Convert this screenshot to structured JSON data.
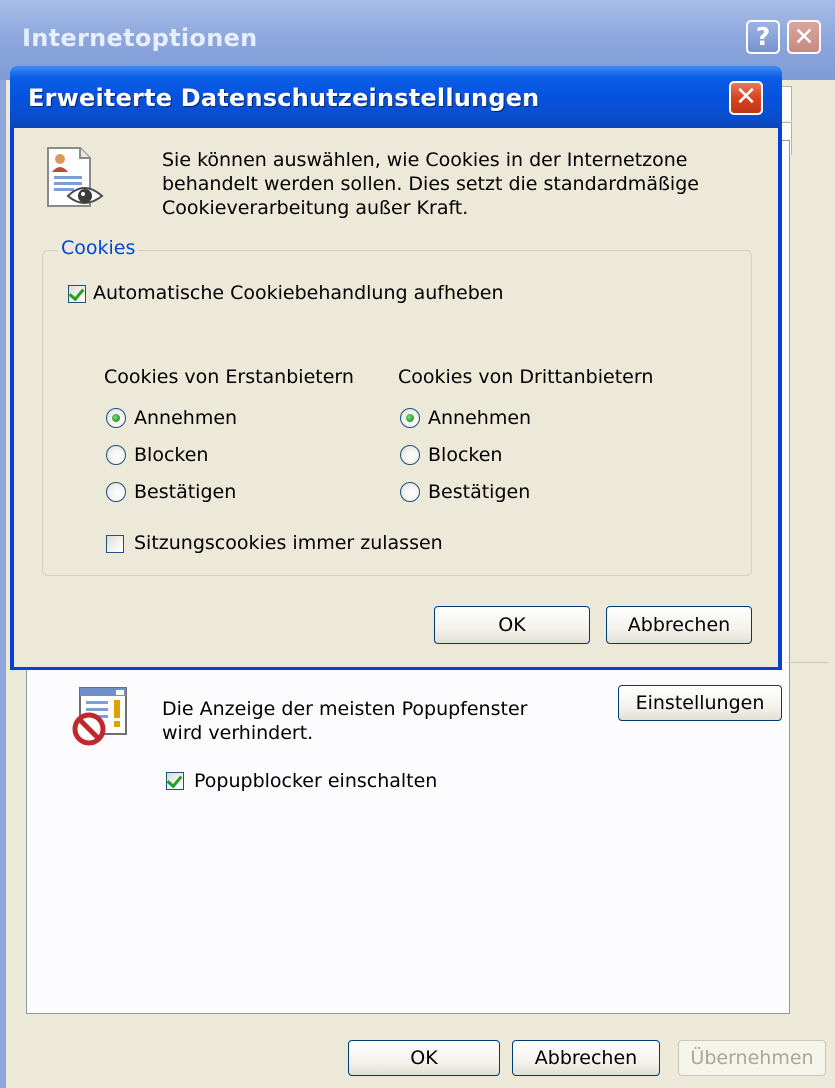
{
  "outer_window": {
    "title": "Internetoptionen",
    "help_button": "?",
    "close_button": "✕",
    "popup_text_line1": "Die Anzeige der meisten Popupfenster",
    "popup_text_line2": "wird verhindert.",
    "popup_settings_button": "Einstellungen",
    "popup_blocker_checkbox": {
      "label": "Popupblocker einschalten",
      "checked": true
    },
    "buttons": {
      "ok": "OK",
      "cancel": "Abbrechen",
      "apply": "Übernehmen"
    }
  },
  "dialog": {
    "title": "Erweiterte Datenschutzeinstellungen",
    "close_button": "✕",
    "info_line1": "Sie können auswählen, wie Cookies in der Internetzone",
    "info_line2": "behandelt werden sollen. Dies setzt die standardmäßige",
    "info_line3": "Cookieverarbeitung außer Kraft.",
    "group_label": "Cookies",
    "override_checkbox": {
      "label": "Automatische Cookiebehandlung aufheben",
      "checked": true
    },
    "first_party": {
      "heading": "Cookies von Erstanbietern",
      "options": [
        "Annehmen",
        "Blocken",
        "Bestätigen"
      ],
      "selected": "Annehmen"
    },
    "third_party": {
      "heading": "Cookies von Drittanbietern",
      "options": [
        "Annehmen",
        "Blocken",
        "Bestätigen"
      ],
      "selected": "Annehmen"
    },
    "session_checkbox": {
      "label": "Sitzungscookies immer zulassen",
      "checked": false
    },
    "buttons": {
      "ok": "OK",
      "cancel": "Abbrechen"
    }
  },
  "colors": {
    "dialog_title_blue": "#0652de",
    "dialog_background": "#ece9d8",
    "group_label_blue": "#0046d5",
    "close_red": "#d9441f",
    "check_green": "#21a121"
  },
  "icons": {
    "info": "privacy-document-eye-icon",
    "popup": "popup-blocked-icon"
  }
}
